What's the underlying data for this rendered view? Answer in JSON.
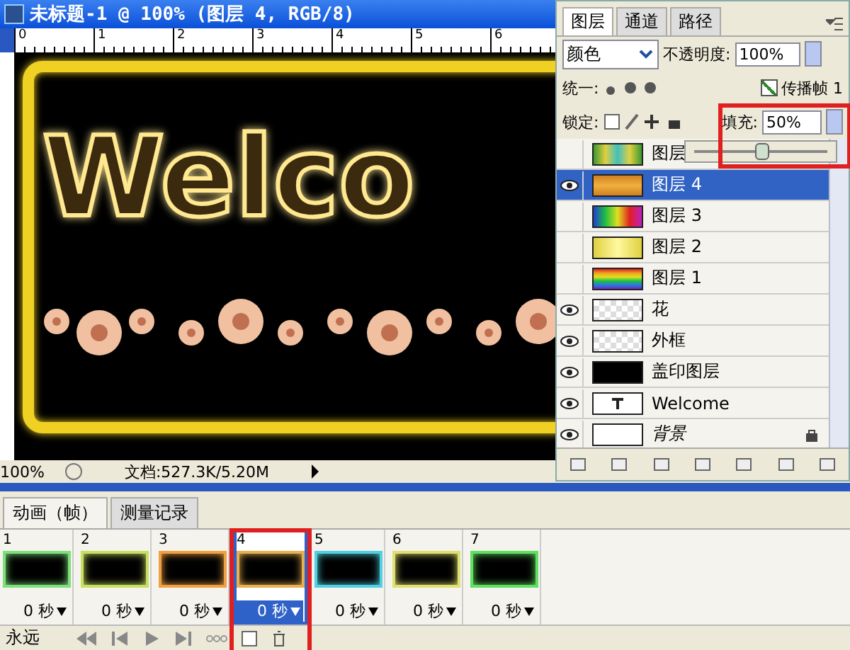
{
  "document": {
    "title": "未标题-1 @ 100% (图层 4, RGB/8)",
    "ruler_marks": [
      "0",
      "1",
      "2",
      "3",
      "4",
      "5",
      "6"
    ],
    "canvas_text": "Welco",
    "zoom": "100%",
    "doc_info": "文档:527.3K/5.20M"
  },
  "layers_panel": {
    "tabs": [
      {
        "label": "图层",
        "selected": true
      },
      {
        "label": "通道",
        "selected": false
      },
      {
        "label": "路径",
        "selected": false
      }
    ],
    "blend_mode": "颜色",
    "opacity_label": "不透明度:",
    "opacity": "100%",
    "unify_label": "统一:",
    "propagate": {
      "label": "传播帧 1",
      "checked": true
    },
    "lock_label": "锁定:",
    "fill_label": "填充:",
    "fill": "50%",
    "fill_slider": {
      "level": 0.5
    },
    "layers": [
      {
        "name": "图层",
        "visible": false,
        "selected": false,
        "locked": false,
        "kind": "spectrum"
      },
      {
        "name": "图层 4",
        "visible": true,
        "selected": true,
        "locked": false,
        "kind": "orange"
      },
      {
        "name": "图层 3",
        "visible": false,
        "selected": false,
        "locked": false,
        "kind": "rainbow"
      },
      {
        "name": "图层 2",
        "visible": false,
        "selected": false,
        "locked": false,
        "kind": "yellow"
      },
      {
        "name": "图层 1",
        "visible": false,
        "selected": false,
        "locked": false,
        "kind": "stripes"
      },
      {
        "name": "花",
        "visible": true,
        "selected": false,
        "locked": false,
        "kind": "transparent"
      },
      {
        "name": "外框",
        "visible": true,
        "selected": false,
        "locked": false,
        "kind": "transparent"
      },
      {
        "name": "盖印图层",
        "visible": true,
        "selected": false,
        "locked": false,
        "kind": "stamp"
      },
      {
        "name": "Welcome",
        "visible": true,
        "selected": false,
        "locked": false,
        "kind": "type"
      },
      {
        "name": "背景",
        "visible": true,
        "selected": false,
        "locked": true,
        "kind": "white"
      }
    ]
  },
  "animation_panel": {
    "tabs": [
      {
        "label": "动画（帧）",
        "selected": true
      },
      {
        "label": "测量记录",
        "selected": false
      }
    ],
    "frames": [
      {
        "number": "1",
        "delay": "0 秒",
        "selected": false,
        "color": "#7ee07a"
      },
      {
        "number": "2",
        "delay": "0 秒",
        "selected": false,
        "color": "#c8e060"
      },
      {
        "number": "3",
        "delay": "0 秒",
        "selected": false,
        "color": "#f0a040"
      },
      {
        "number": "4",
        "delay": "0 秒",
        "selected": true,
        "color": "#e8b050"
      },
      {
        "number": "5",
        "delay": "0 秒",
        "selected": false,
        "color": "#50d0e0"
      },
      {
        "number": "6",
        "delay": "0 秒",
        "selected": false,
        "color": "#e0e070"
      },
      {
        "number": "7",
        "delay": "0 秒",
        "selected": false,
        "color": "#60e060"
      }
    ],
    "loop": "永远"
  }
}
